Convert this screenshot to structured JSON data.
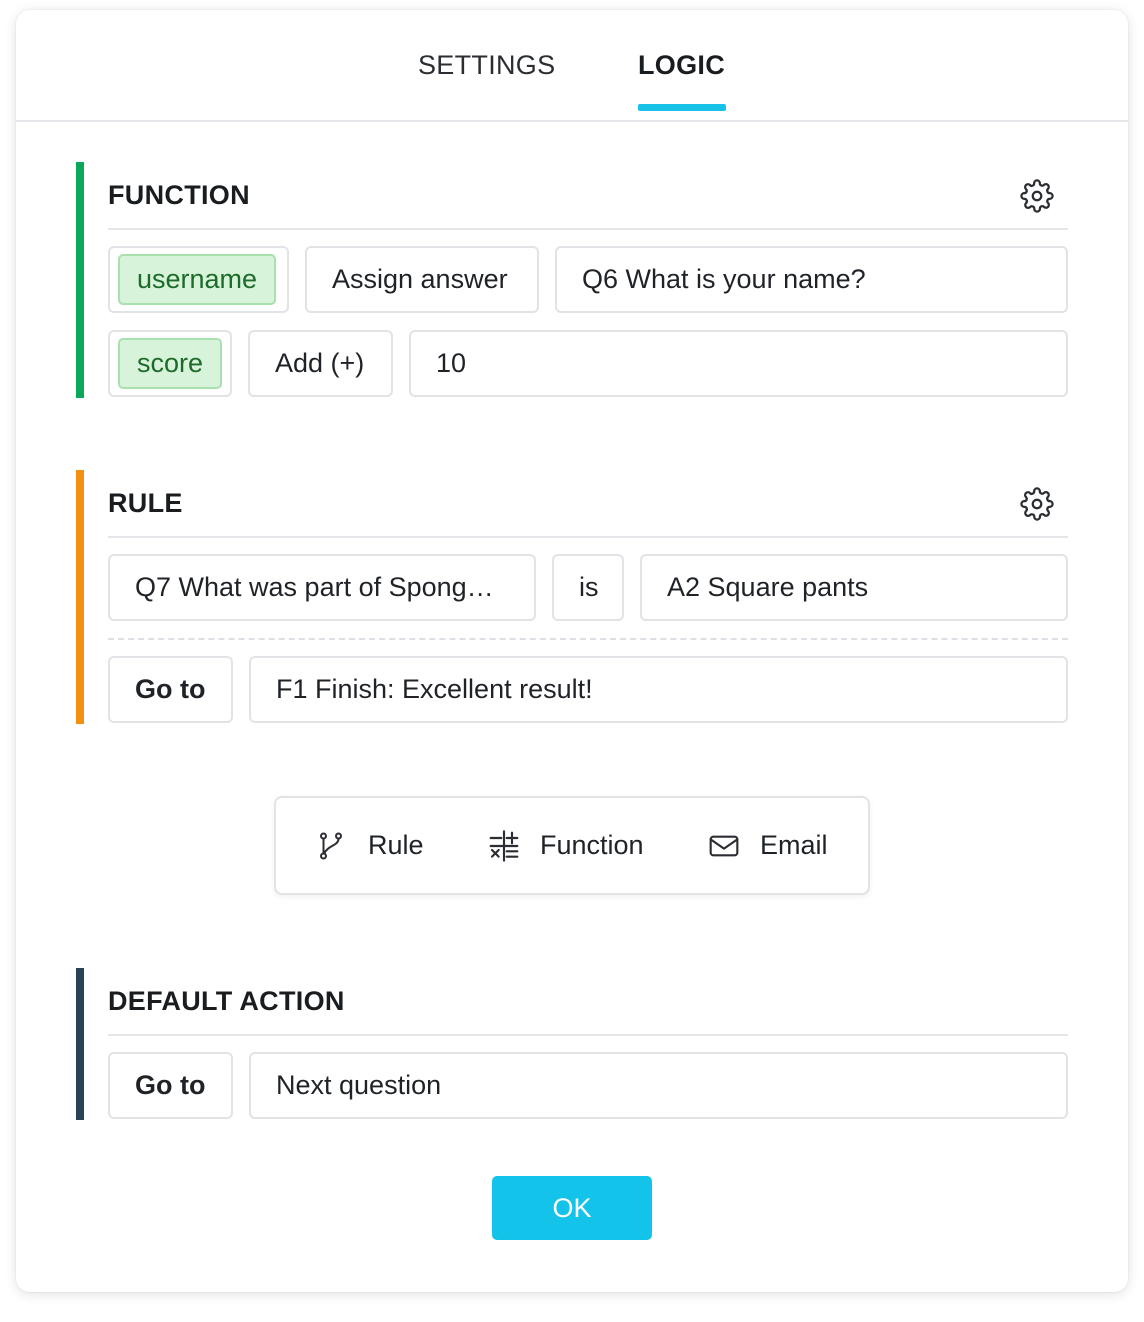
{
  "tabs": [
    {
      "label": "SETTINGS",
      "active": false
    },
    {
      "label": "LOGIC",
      "active": true
    }
  ],
  "colors": {
    "accent": "#18c1e8",
    "function_bar": "#0aa85a",
    "rule_bar": "#f5900f",
    "default_bar": "#2b4256",
    "chip_bg": "#d7f3d9",
    "chip_text": "#1c6b2a"
  },
  "function_section": {
    "title": "FUNCTION",
    "icon": "gear-icon",
    "rows": [
      {
        "variable": "username",
        "operation": "Assign answer",
        "value": "Q6 What is your name?"
      },
      {
        "variable": "score",
        "operation": "Add (+)",
        "value": "10"
      }
    ]
  },
  "rule_section": {
    "title": "RULE",
    "icon": "gear-icon",
    "condition": {
      "question": "Q7 What was part of Spong…",
      "operator": "is",
      "answer": "A2 Square pants"
    },
    "action": {
      "label": "Go to",
      "target": "F1 Finish: Excellent result!"
    }
  },
  "add_bar": {
    "items": [
      {
        "label": "Rule",
        "icon": "branch-icon"
      },
      {
        "label": "Function",
        "icon": "calculator-icon"
      },
      {
        "label": "Email",
        "icon": "envelope-icon"
      }
    ]
  },
  "default_section": {
    "title": "DEFAULT ACTION",
    "action": {
      "label": "Go to",
      "target": "Next question"
    }
  },
  "ok_label": "OK"
}
